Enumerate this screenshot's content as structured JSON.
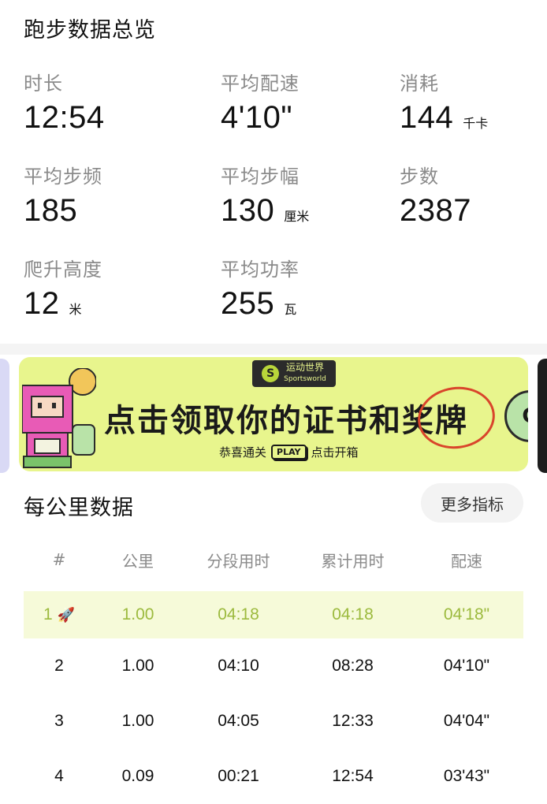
{
  "summary": {
    "title": "跑步数据总览",
    "stats": [
      {
        "label": "时长",
        "value": "12:54",
        "unit": ""
      },
      {
        "label": "平均配速",
        "value": "4'10\"",
        "unit": ""
      },
      {
        "label": "消耗",
        "value": "144",
        "unit": "千卡"
      },
      {
        "label": "平均步频",
        "value": "185",
        "unit": ""
      },
      {
        "label": "平均步幅",
        "value": "130",
        "unit": "厘米"
      },
      {
        "label": "步数",
        "value": "2387",
        "unit": ""
      },
      {
        "label": "爬升高度",
        "value": "12",
        "unit": "米"
      },
      {
        "label": "平均功率",
        "value": "255",
        "unit": "瓦"
      }
    ]
  },
  "banner": {
    "brand_cn": "运动世界",
    "brand_en": "Sportsworld",
    "headline": "点击领取你的证书和奖牌",
    "sub_left": "恭喜通关",
    "play_label": "PLAY",
    "sub_right": "点击开箱",
    "badge_letter": "G",
    "accent_color": "#e8f58d"
  },
  "splits": {
    "title": "每公里数据",
    "more_button": "更多指标",
    "columns": [
      "#",
      "公里",
      "分段用时",
      "累计用时",
      "配速"
    ],
    "rows": [
      {
        "idx": "1",
        "km": "1.00",
        "segment": "04:18",
        "cumulative": "04:18",
        "pace": "04'18\"",
        "best": true,
        "icon": "rocket-icon"
      },
      {
        "idx": "2",
        "km": "1.00",
        "segment": "04:10",
        "cumulative": "08:28",
        "pace": "04'10\"",
        "best": false
      },
      {
        "idx": "3",
        "km": "1.00",
        "segment": "04:05",
        "cumulative": "12:33",
        "pace": "04'04\"",
        "best": false
      },
      {
        "idx": "4",
        "km": "0.09",
        "segment": "00:21",
        "cumulative": "12:54",
        "pace": "03'43\"",
        "best": false
      }
    ],
    "best_color": "#9cba3e"
  }
}
